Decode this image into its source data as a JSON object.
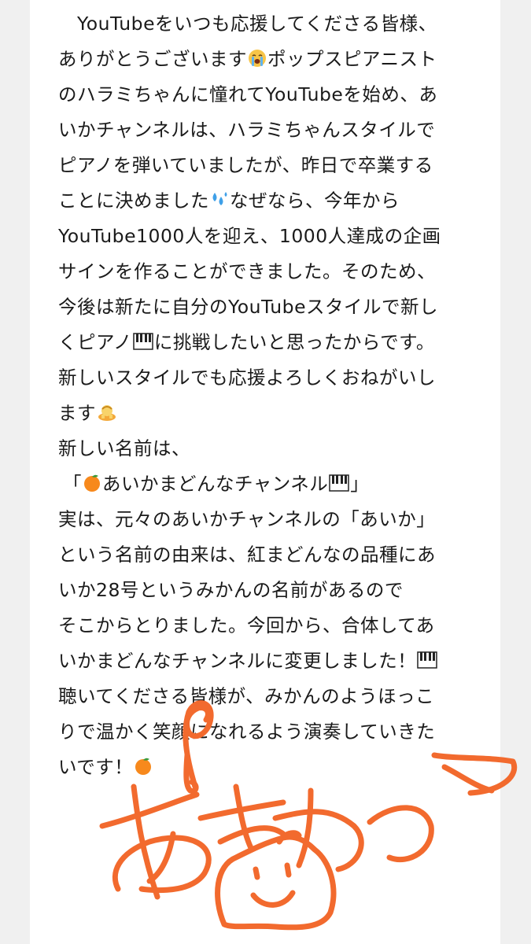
{
  "lines": [
    {
      "text": "YouTubeをいつも応援してくださる皆様、"
    },
    {
      "text": "ありがとうございます",
      "emoji": "crying-face-icon",
      "after": "ポップスピアニスト"
    },
    {
      "text": "のハラミちゃんに憧れてYouTubeを始め、あ"
    },
    {
      "text": "いかチャンネルは、ハラミちゃんスタイルで"
    },
    {
      "text": "ピアノを弾いていましたが、昨日で卒業する"
    },
    {
      "text": "ことに決めました",
      "emoji": "sweat-droplets-icon",
      "after": "なぜなら、今年から"
    },
    {
      "text": "YouTube1000人を迎え、1000人達成の企画"
    },
    {
      "text": "サインを作ることができました。そのため、"
    },
    {
      "text": "今後は新たに自分のYouTubeスタイルで新し"
    },
    {
      "text": "くピアノ",
      "emoji": "piano-keyboard-icon",
      "after": "に挑戦したいと思ったからです。"
    },
    {
      "text": "新しいスタイルでも応援よろしくおねがいし"
    },
    {
      "text": "ます",
      "emoji": "bowing-person-icon",
      "after": ""
    },
    {
      "text": "新しい名前は、"
    },
    {
      "text": "「",
      "emoji": "orange-icon",
      "after": "あいかまどんなチャンネル",
      "emoji2": "piano-keyboard-icon",
      "after2": "」"
    },
    {
      "text": "実は、元々のあいかチャンネルの「あいか」"
    },
    {
      "text": "という名前の由来は、紅まどんなの品種にあ"
    },
    {
      "text": "いか28号というみかんの名前があるので"
    },
    {
      "text": "そこからとりました。今回から、合体してあ"
    },
    {
      "text": "いかまどんなチャンネルに変更しました！",
      "emoji": "piano-keyboard-icon",
      "after": ""
    },
    {
      "text": "聴いてくださる皆様が、みかんのようほっこ"
    },
    {
      "text": "りで温かく笑顔になれるよう演奏していきた"
    },
    {
      "text": "いです！",
      "emoji": "orange-icon",
      "after": ""
    }
  ],
  "colors": {
    "text": "#1a1a1a",
    "signature": "#f26a2e",
    "background": "#ffffff"
  }
}
